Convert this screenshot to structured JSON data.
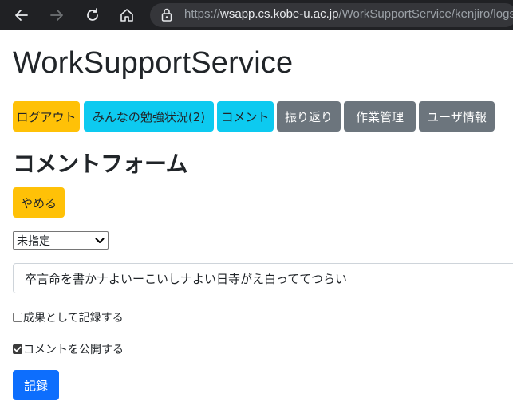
{
  "browser": {
    "url_scheme": "https://",
    "url_host": "wsapp.cs.kobe-u.ac.jp",
    "url_path": "/WorkSupportService/kenjiro/logs"
  },
  "page": {
    "title": "WorkSupportService"
  },
  "nav": {
    "logout": "ログアウト",
    "everyone_status": "みんなの勉強状況(2)",
    "comment": "コメント",
    "review": "振り返り",
    "task_manage": "作業管理",
    "user_info": "ユーザ情報"
  },
  "form": {
    "heading": "コメントフォーム",
    "cancel_label": "やめる",
    "category_selected": "未指定",
    "comment_value": "卒言命を書かナよいーこいしナよい日寺がえ白っててつらい",
    "record_as_result_label": "成果として記録する",
    "record_as_result_checked": false,
    "publish_comment_label": "コメントを公開する",
    "publish_comment_checked": true,
    "submit_label": "記録"
  },
  "colors": {
    "warning": "#ffc107",
    "info": "#0dcaf0",
    "secondary": "#6c757d",
    "primary": "#0d6efd"
  }
}
